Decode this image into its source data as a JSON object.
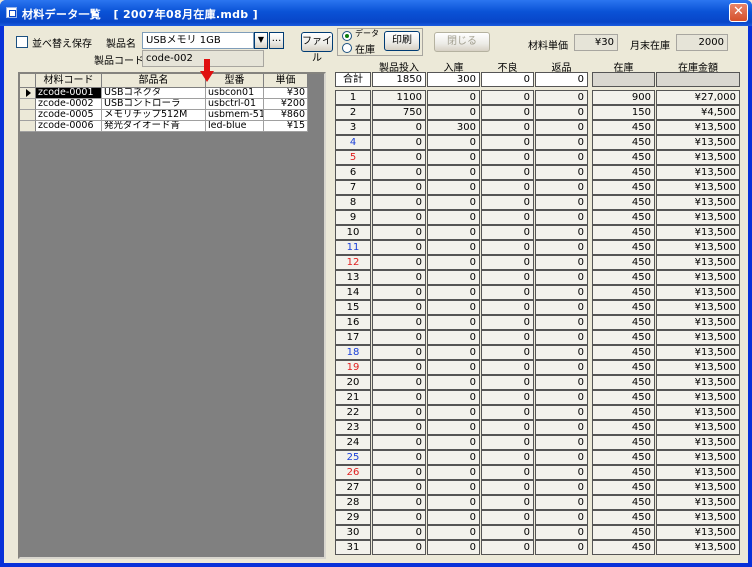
{
  "window": {
    "title": "材料データ一覧   [ 2007年08月在庫.mdb ]",
    "close_label": "✕"
  },
  "top": {
    "sort_save_label": "並べ替え保存",
    "product_name_label": "製品名",
    "product_name_value": "USBメモリ 1GB",
    "browse_label": "...",
    "product_code_label": "製品コード",
    "product_code_value": "code-002",
    "file_button": "ファイル",
    "radio_data_label": "データ",
    "radio_stock_label": "在庫",
    "print_button": "印刷",
    "close_button": "閉じる",
    "unit_price_label": "材料単価",
    "unit_price_value": "¥30",
    "month_end_stock_label": "月末在庫",
    "month_end_stock_value": "2000"
  },
  "left_grid": {
    "headers": [
      "材料コード",
      "部品名",
      "型番",
      "単価"
    ],
    "rows": [
      [
        "zcode-0001",
        "USBコネクタ",
        "usbcon01",
        "¥30"
      ],
      [
        "zcode-0002",
        "USBコントローラ",
        "usbctrl-01",
        "¥200"
      ],
      [
        "zcode-0005",
        "メモリチップ512M",
        "usbmem-51",
        "¥860"
      ],
      [
        "zcode-0006",
        "発光ダイオード青",
        "led-blue",
        "¥15"
      ]
    ]
  },
  "right_grid": {
    "headers": [
      "製品投入",
      "入庫",
      "不良",
      "返品",
      "在庫",
      "在庫金額"
    ],
    "total_label": "合計",
    "total": [
      "1850",
      "300",
      "0",
      "0",
      "",
      ""
    ],
    "rows": [
      [
        "1",
        "1100",
        "0",
        "0",
        "0",
        "900",
        "¥27,000"
      ],
      [
        "2",
        "750",
        "0",
        "0",
        "0",
        "150",
        "¥4,500"
      ],
      [
        "3",
        "0",
        "300",
        "0",
        "0",
        "450",
        "¥13,500"
      ],
      [
        "4",
        "0",
        "0",
        "0",
        "0",
        "450",
        "¥13,500"
      ],
      [
        "5",
        "0",
        "0",
        "0",
        "0",
        "450",
        "¥13,500"
      ],
      [
        "6",
        "0",
        "0",
        "0",
        "0",
        "450",
        "¥13,500"
      ],
      [
        "7",
        "0",
        "0",
        "0",
        "0",
        "450",
        "¥13,500"
      ],
      [
        "8",
        "0",
        "0",
        "0",
        "0",
        "450",
        "¥13,500"
      ],
      [
        "9",
        "0",
        "0",
        "0",
        "0",
        "450",
        "¥13,500"
      ],
      [
        "10",
        "0",
        "0",
        "0",
        "0",
        "450",
        "¥13,500"
      ],
      [
        "11",
        "0",
        "0",
        "0",
        "0",
        "450",
        "¥13,500"
      ],
      [
        "12",
        "0",
        "0",
        "0",
        "0",
        "450",
        "¥13,500"
      ],
      [
        "13",
        "0",
        "0",
        "0",
        "0",
        "450",
        "¥13,500"
      ],
      [
        "14",
        "0",
        "0",
        "0",
        "0",
        "450",
        "¥13,500"
      ],
      [
        "15",
        "0",
        "0",
        "0",
        "0",
        "450",
        "¥13,500"
      ],
      [
        "16",
        "0",
        "0",
        "0",
        "0",
        "450",
        "¥13,500"
      ],
      [
        "17",
        "0",
        "0",
        "0",
        "0",
        "450",
        "¥13,500"
      ],
      [
        "18",
        "0",
        "0",
        "0",
        "0",
        "450",
        "¥13,500"
      ],
      [
        "19",
        "0",
        "0",
        "0",
        "0",
        "450",
        "¥13,500"
      ],
      [
        "20",
        "0",
        "0",
        "0",
        "0",
        "450",
        "¥13,500"
      ],
      [
        "21",
        "0",
        "0",
        "0",
        "0",
        "450",
        "¥13,500"
      ],
      [
        "22",
        "0",
        "0",
        "0",
        "0",
        "450",
        "¥13,500"
      ],
      [
        "23",
        "0",
        "0",
        "0",
        "0",
        "450",
        "¥13,500"
      ],
      [
        "24",
        "0",
        "0",
        "0",
        "0",
        "450",
        "¥13,500"
      ],
      [
        "25",
        "0",
        "0",
        "0",
        "0",
        "450",
        "¥13,500"
      ],
      [
        "26",
        "0",
        "0",
        "0",
        "0",
        "450",
        "¥13,500"
      ],
      [
        "27",
        "0",
        "0",
        "0",
        "0",
        "450",
        "¥13,500"
      ],
      [
        "28",
        "0",
        "0",
        "0",
        "0",
        "450",
        "¥13,500"
      ],
      [
        "29",
        "0",
        "0",
        "0",
        "0",
        "450",
        "¥13,500"
      ],
      [
        "30",
        "0",
        "0",
        "0",
        "0",
        "450",
        "¥13,500"
      ],
      [
        "31",
        "0",
        "0",
        "0",
        "0",
        "450",
        "¥13,500"
      ]
    ],
    "blue_days": [
      "4",
      "11",
      "18",
      "25"
    ],
    "red_days": [
      "5",
      "12",
      "19",
      "26"
    ]
  },
  "colors": {
    "saturday": "#1a3fd8",
    "sunday": "#e02020",
    "arrow": "#e01010",
    "title_bar": "#0a52d6"
  }
}
